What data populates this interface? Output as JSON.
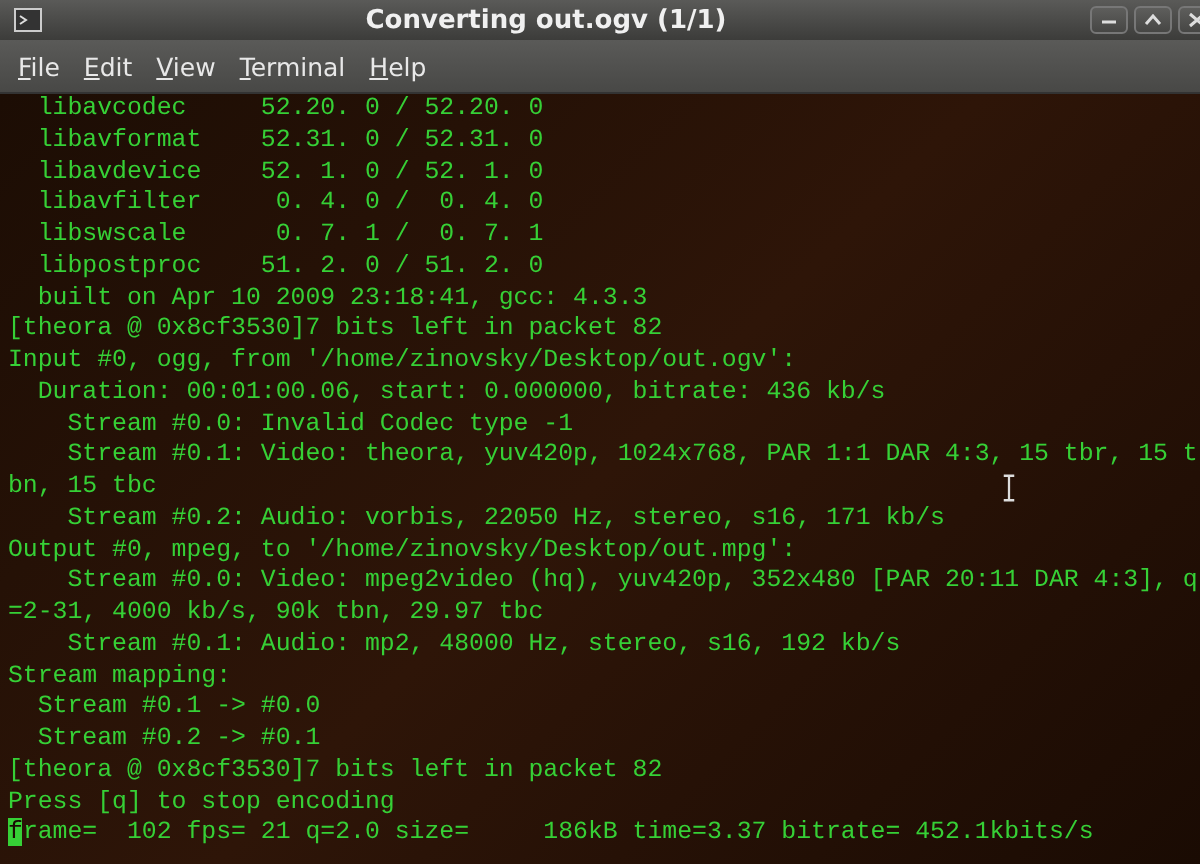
{
  "window": {
    "title": "Converting out.ogv (1/1)"
  },
  "menu": [
    "File",
    "Edit",
    "View",
    "Terminal",
    "Help"
  ],
  "terminal": {
    "lines": [
      {
        "text": "  libavcodec     52.20. 0 / 52.20. 0",
        "cursor": false
      },
      {
        "text": "  libavformat    52.31. 0 / 52.31. 0",
        "cursor": false
      },
      {
        "text": "  libavdevice    52. 1. 0 / 52. 1. 0",
        "cursor": false
      },
      {
        "text": "  libavfilter     0. 4. 0 /  0. 4. 0",
        "cursor": false
      },
      {
        "text": "  libswscale      0. 7. 1 /  0. 7. 1",
        "cursor": false
      },
      {
        "text": "  libpostproc    51. 2. 0 / 51. 2. 0",
        "cursor": false
      },
      {
        "text": "  built on Apr 10 2009 23:18:41, gcc: 4.3.3",
        "cursor": false
      },
      {
        "text": "[theora @ 0x8cf3530]7 bits left in packet 82",
        "cursor": false
      },
      {
        "text": "Input #0, ogg, from '/home/zinovsky/Desktop/out.ogv':",
        "cursor": false
      },
      {
        "text": "  Duration: 00:01:00.06, start: 0.000000, bitrate: 436 kb/s",
        "cursor": false
      },
      {
        "text": "    Stream #0.0: Invalid Codec type -1",
        "cursor": false
      },
      {
        "text": "    Stream #0.1: Video: theora, yuv420p, 1024x768, PAR 1:1 DAR 4:3, 15 tbr, 15 t",
        "cursor": false
      },
      {
        "text": "bn, 15 tbc",
        "cursor": false
      },
      {
        "text": "    Stream #0.2: Audio: vorbis, 22050 Hz, stereo, s16, 171 kb/s",
        "cursor": false
      },
      {
        "text": "Output #0, mpeg, to '/home/zinovsky/Desktop/out.mpg':",
        "cursor": false
      },
      {
        "text": "    Stream #0.0: Video: mpeg2video (hq), yuv420p, 352x480 [PAR 20:11 DAR 4:3], q",
        "cursor": false
      },
      {
        "text": "=2-31, 4000 kb/s, 90k tbn, 29.97 tbc",
        "cursor": false
      },
      {
        "text": "    Stream #0.1: Audio: mp2, 48000 Hz, stereo, s16, 192 kb/s",
        "cursor": false
      },
      {
        "text": "Stream mapping:",
        "cursor": false
      },
      {
        "text": "  Stream #0.1 -> #0.0",
        "cursor": false
      },
      {
        "text": "  Stream #0.2 -> #0.1",
        "cursor": false
      },
      {
        "text": "[theora @ 0x8cf3530]7 bits left in packet 82",
        "cursor": false
      },
      {
        "text": "Press [q] to stop encoding",
        "cursor": false
      },
      {
        "text": "frame=  102 fps= 21 q=2.0 size=     186kB time=3.37 bitrate= 452.1kbits/s",
        "cursor": true
      }
    ]
  }
}
